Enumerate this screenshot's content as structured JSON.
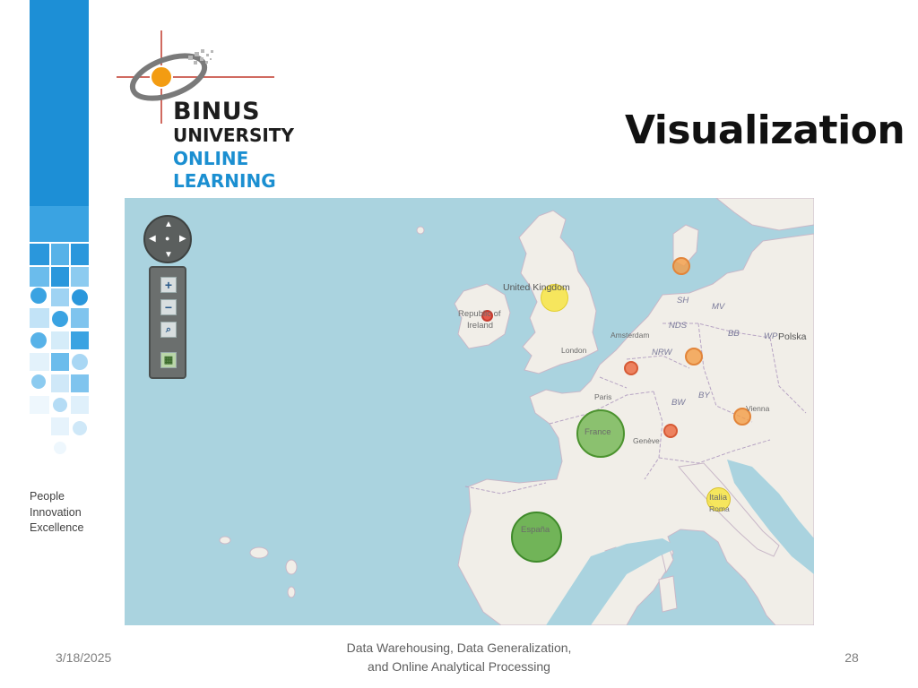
{
  "slide": {
    "title": "Visualization",
    "date": "3/18/2025",
    "footer_line1": "Data Warehousing, Data Generalization,",
    "footer_line2": "and Online Analytical Processing",
    "page_number": "28"
  },
  "logo": {
    "line1": "BINUS",
    "line2": "UNIVERSITY",
    "line3": "ONLINE",
    "line4": "LEARNING"
  },
  "tagline": [
    "People",
    "Innovation",
    "Excellence"
  ],
  "map": {
    "labels": {
      "uk": "United Kingdom",
      "ireland1": "Republic of",
      "ireland2": "Ireland",
      "london": "London",
      "amsterdam": "Amsterdam",
      "paris": "Paris",
      "france": "France",
      "geneve": "Genève",
      "espana": "España",
      "italia": "Italia",
      "roma": "Roma",
      "vienna": "Vienna",
      "polska": "Polska",
      "sh": "SH",
      "mv": "MV",
      "nds": "NDS",
      "bb": "BB",
      "wp": "WP",
      "nrw": "NRW",
      "by": "BY",
      "bw": "BW"
    },
    "controls": {
      "zoom_in": "+",
      "zoom_out": "−"
    }
  },
  "colors": {
    "sea": "#aad3df",
    "land": "#f1eee8",
    "bubble_green": "#5fae3c",
    "bubble_yellow": "#f7e43a",
    "bubble_orange": "#f49c45",
    "bubble_red": "#e2483a"
  },
  "icons": [
    "pan-control-icon",
    "zoom-in-icon",
    "zoom-out-icon",
    "zoom-box-icon",
    "layer-switcher-icon",
    "binus-globe-logo"
  ]
}
